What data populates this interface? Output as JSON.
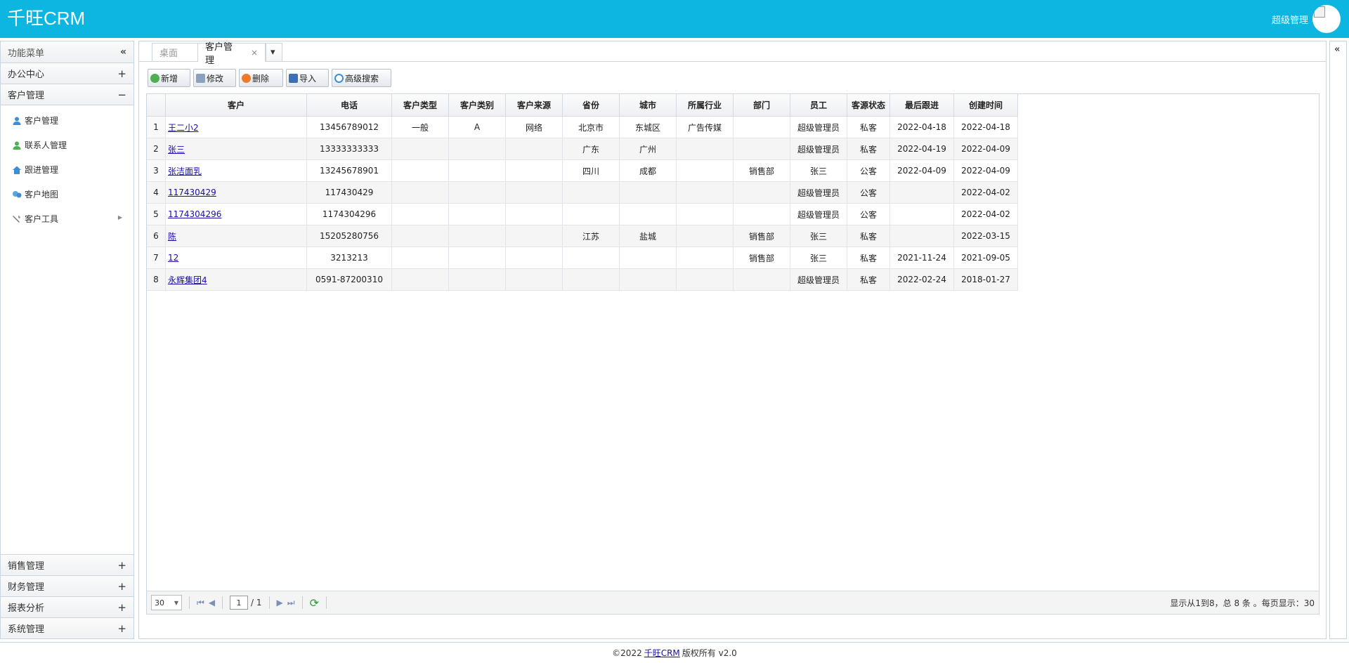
{
  "app": {
    "brand": "千旺CRM",
    "username": "超级管理"
  },
  "sidebar": {
    "title": "功能菜单",
    "collapse_glyph": "«",
    "sections_top": [
      {
        "label": "办公中心",
        "state": "+"
      },
      {
        "label": "客户管理",
        "state": "−"
      }
    ],
    "items": [
      {
        "label": "客户管理",
        "icon": "user-icon"
      },
      {
        "label": "联系人管理",
        "icon": "contact-icon"
      },
      {
        "label": "跟进管理",
        "icon": "home-icon"
      },
      {
        "label": "客户地图",
        "icon": "map-icon"
      },
      {
        "label": "客户工具",
        "icon": "tools-icon"
      }
    ],
    "sections_bottom": [
      {
        "label": "销售管理",
        "state": "+"
      },
      {
        "label": "财务管理",
        "state": "+"
      },
      {
        "label": "报表分析",
        "state": "+"
      },
      {
        "label": "系统管理",
        "state": "+"
      }
    ]
  },
  "tabs": {
    "desktop": "桌面",
    "current": "客户管理",
    "close": "×",
    "more": "▾"
  },
  "toolbar": {
    "add": "新增",
    "edit": "修改",
    "delete": "删除",
    "import": "导入",
    "advanced_search": "高级搜索"
  },
  "table": {
    "columns": [
      "客户",
      "电话",
      "客户类型",
      "客户类别",
      "客户来源",
      "省份",
      "城市",
      "所属行业",
      "部门",
      "员工",
      "客源状态",
      "最后跟进",
      "创建时间"
    ],
    "rows": [
      [
        "1",
        "王二小2",
        "13456789012",
        "一般",
        "A",
        "网络",
        "北京市",
        "东城区",
        "广告传媒",
        "",
        "超级管理员",
        "私客",
        "2022-04-18",
        "2022-04-18"
      ],
      [
        "2",
        "张三",
        "13333333333",
        "",
        "",
        "",
        "广东",
        "广州",
        "",
        "",
        "超级管理员",
        "私客",
        "2022-04-19",
        "2022-04-09"
      ],
      [
        "3",
        "张洁面乳",
        "13245678901",
        "",
        "",
        "",
        "四川",
        "成都",
        "",
        "销售部",
        "张三",
        "公客",
        "2022-04-09",
        "2022-04-09"
      ],
      [
        "4",
        "117430429",
        "117430429",
        "",
        "",
        "",
        "",
        "",
        "",
        "",
        "超级管理员",
        "公客",
        "",
        "2022-04-02"
      ],
      [
        "5",
        "1174304296",
        "1174304296",
        "",
        "",
        "",
        "",
        "",
        "",
        "",
        "超级管理员",
        "公客",
        "",
        "2022-04-02"
      ],
      [
        "6",
        "陈",
        "15205280756",
        "",
        "",
        "",
        "江苏",
        "盐城",
        "",
        "销售部",
        "张三",
        "私客",
        "",
        "2022-03-15"
      ],
      [
        "7",
        "12",
        "3213213",
        "",
        "",
        "",
        "",
        "",
        "",
        "销售部",
        "张三",
        "私客",
        "2021-11-24",
        "2021-09-05"
      ],
      [
        "8",
        "永辉集团4",
        "0591-87200310",
        "",
        "",
        "",
        "",
        "",
        "",
        "",
        "超级管理员",
        "私客",
        "2022-02-24",
        "2018-01-27"
      ]
    ]
  },
  "pager": {
    "page_size": "30",
    "page": "1",
    "total_pages": "/ 1",
    "info": "显示从1到8，总 8 条 。每页显示：30"
  },
  "footer": {
    "prefix": "©2022",
    "link": "千旺CRM",
    "suffix": "版权所有 v2.0"
  }
}
